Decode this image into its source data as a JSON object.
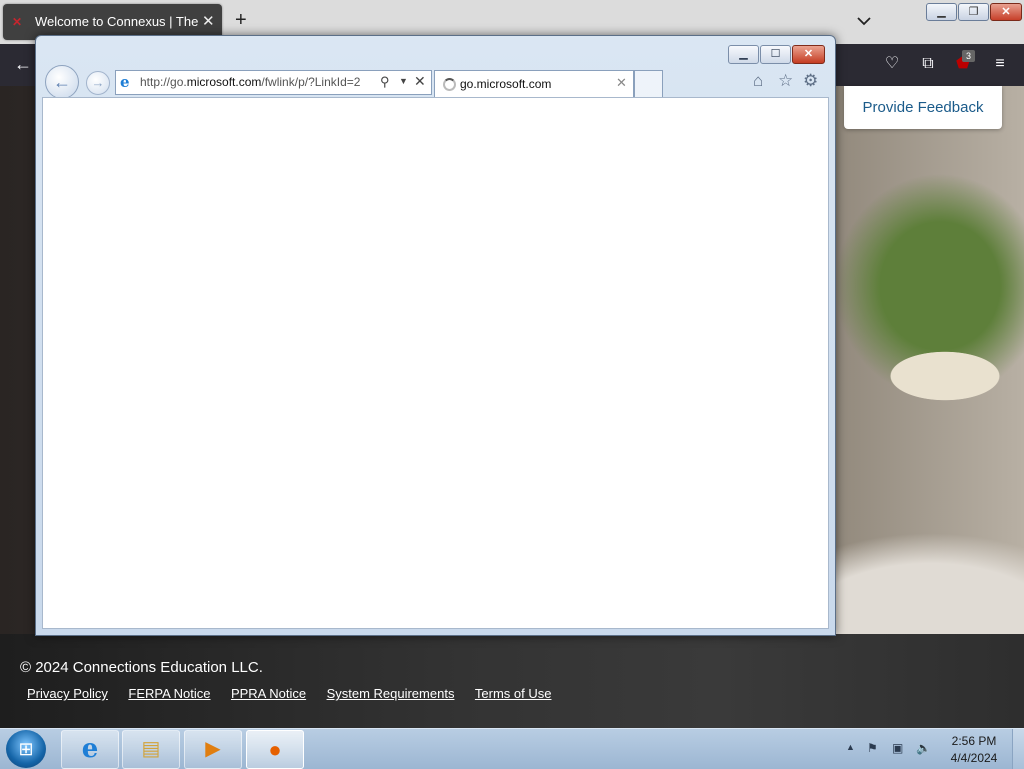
{
  "firefox": {
    "tab": {
      "title": "Welcome to Connexus | The Education"
    },
    "new_tab_label": "+",
    "ublock_badge": "3"
  },
  "page": {
    "feedback_button": "Provide Feedback",
    "footer": {
      "copyright": "© 2024 Connections Education LLC.",
      "links": [
        "Privacy Policy",
        "FERPA Notice",
        "PPRA Notice",
        "System Requirements",
        "Terms of Use"
      ]
    }
  },
  "ie": {
    "address_url_prefix": "http://go.",
    "address_url_domain": "microsoft.com",
    "address_url_suffix": "/fwlink/p/?LinkId=2",
    "tab_title": "go.microsoft.com"
  },
  "taskbar": {
    "apps": [
      "internet-explorer",
      "windows-explorer",
      "media-player",
      "firefox"
    ],
    "clock_time": "2:56 PM",
    "clock_date": "4/4/2024"
  },
  "colors": {
    "firefox_toolbar": "#2b2a33",
    "feedback_text": "#1b5b8a",
    "ie_frame": "#dae6f3",
    "taskbar": "#b8cde3"
  }
}
